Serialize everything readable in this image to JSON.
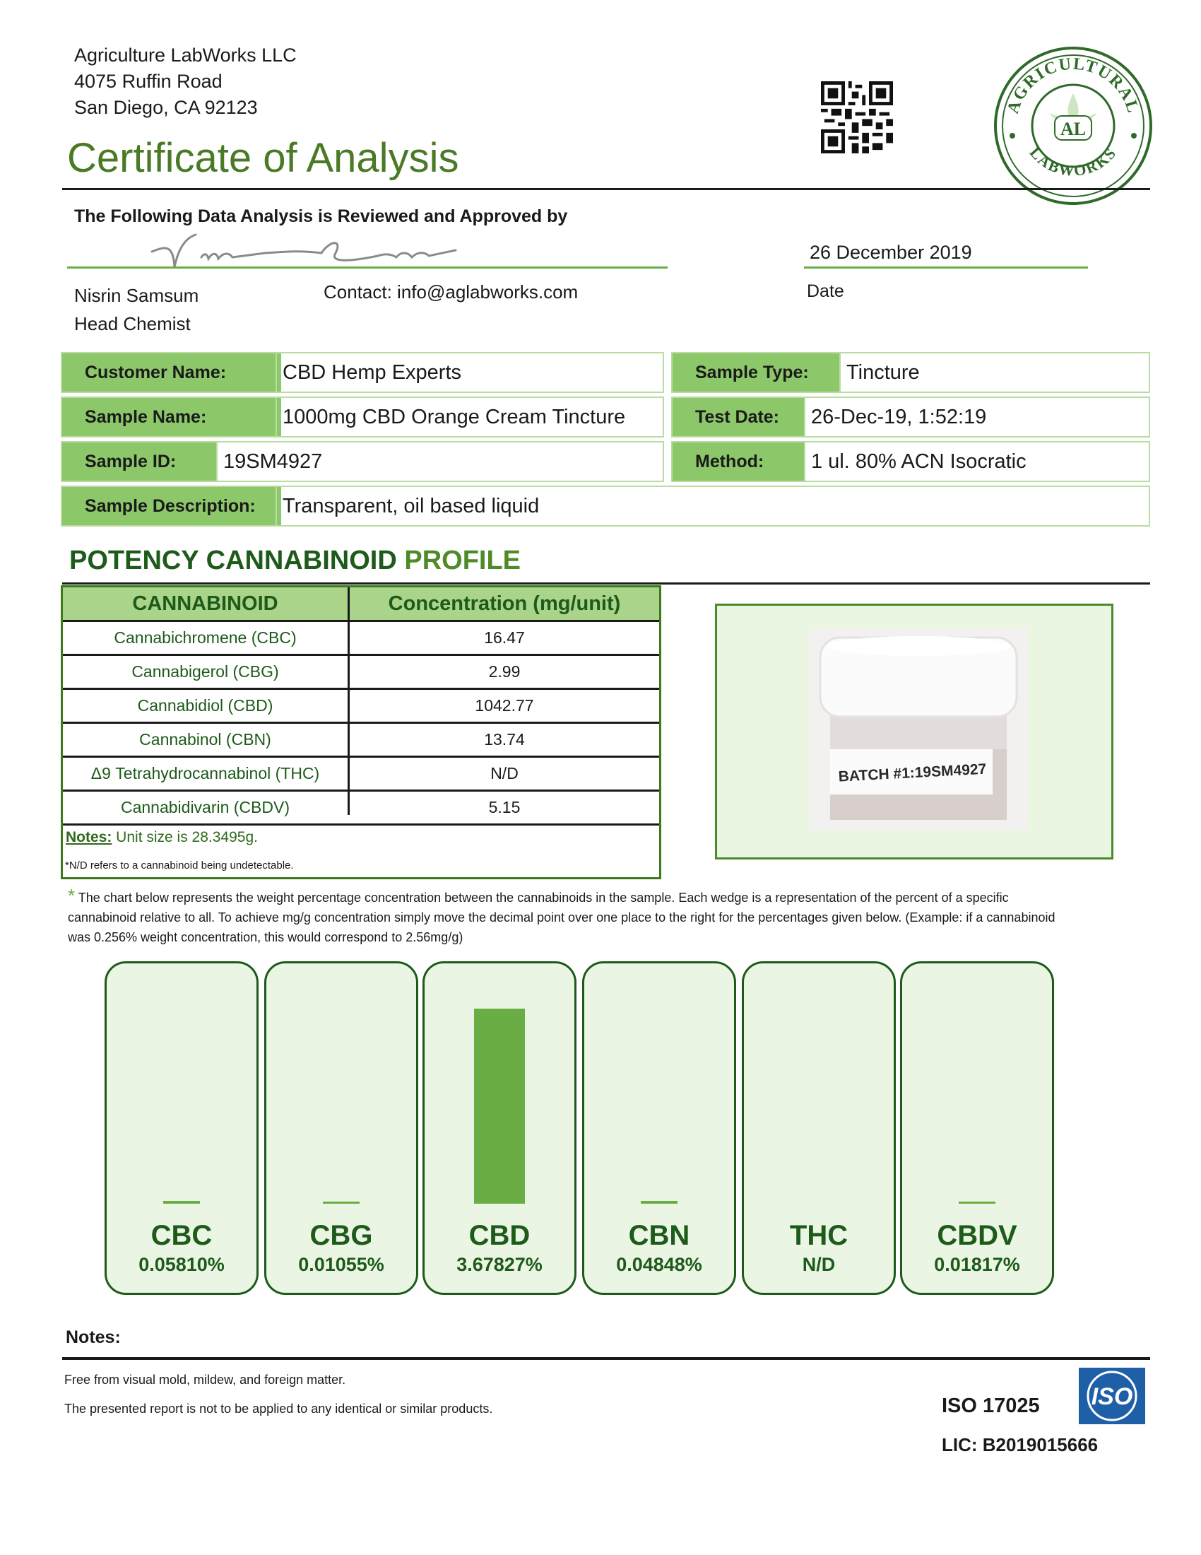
{
  "lab": {
    "name": "Agriculture LabWorks LLC",
    "street": "4075 Ruffin Road",
    "city": "San Diego, CA 92123",
    "seal_text_top": "AGRICULTURAL",
    "seal_text_bottom": "LABWORKS",
    "seal_initials": "AL"
  },
  "title": "Certificate of Analysis",
  "approval": {
    "heading": "The Following Data Analysis is Reviewed and Approved by",
    "date": "26 December 2019",
    "date_label": "Date",
    "name": "Nisrin Samsum",
    "role": "Head Chemist",
    "contact": "Contact: info@aglabworks.com"
  },
  "sample": {
    "customer_label": "Customer Name:",
    "customer": "CBD Hemp Experts",
    "type_label": "Sample Type:",
    "type": "Tincture",
    "name_label": "Sample Name:",
    "name": "1000mg CBD Orange Cream Tincture",
    "test_date_label": "Test Date:",
    "test_date": "26-Dec-19, 1:52:19",
    "id_label": "Sample ID:",
    "id": "19SM4927",
    "method_label": "Method:",
    "method": "1 ul. 80% ACN Isocratic",
    "desc_label": "Sample Description:",
    "desc": "Transparent, oil based liquid"
  },
  "potency": {
    "heading_a": "POTENCY CANNABINOID",
    "heading_b": "PROFILE",
    "col1": "CANNABINOID",
    "col2": "Concentration (mg/unit)",
    "rows": [
      {
        "name": "Cannabichromene (CBC)",
        "value": "16.47"
      },
      {
        "name": "Cannabigerol (CBG)",
        "value": "2.99"
      },
      {
        "name": "Cannabidiol (CBD)",
        "value": "1042.77"
      },
      {
        "name": "Cannabinol (CBN)",
        "value": "13.74"
      },
      {
        "name": "Δ9 Tetrahydrocannabinol (THC)",
        "value": "N/D"
      },
      {
        "name": "Cannabidivarin (CBDV)",
        "value": "5.15"
      }
    ],
    "notes_label": "Notes:",
    "notes_text": " Unit size is 28.3495g.",
    "nd_note": "*N/D refers to a cannabinoid being undetectable.",
    "photo_label": "BATCH #1:19SM4927"
  },
  "chart_note": {
    "star": "*",
    "text": " The chart below represents the weight percentage concentration between the cannabinoids in the sample. Each wedge is a representation of the percent of a specific cannabinoid relative to all. To achieve mg/g concentration simply move the decimal point over one place to the right for the percentages given below. (Example:  if a cannabinoid was 0.256% weight concentration, this would correspond to 2.56mg/g)"
  },
  "chart_data": {
    "type": "bar",
    "categories": [
      "CBC",
      "CBG",
      "CBD",
      "CBN",
      "THC",
      "CBDV"
    ],
    "values": [
      0.0581,
      0.01055,
      3.67827,
      0.04848,
      0,
      0.01817
    ],
    "value_labels": [
      "0.05810%",
      "0.01055%",
      "3.67827%",
      "0.04848%",
      "N/D",
      "0.01817%"
    ],
    "ylim": [
      0,
      3.68
    ],
    "bar_color": "#6aad45"
  },
  "footer": {
    "notes_heading": "Notes:",
    "line1": "Free from visual mold, mildew, and foreign matter.",
    "line2": "The presented report is not to be applied to any identical or similar products.",
    "iso": "ISO 17025",
    "lic": "LIC: B2019015666",
    "iso_logo_text": "ISO"
  }
}
